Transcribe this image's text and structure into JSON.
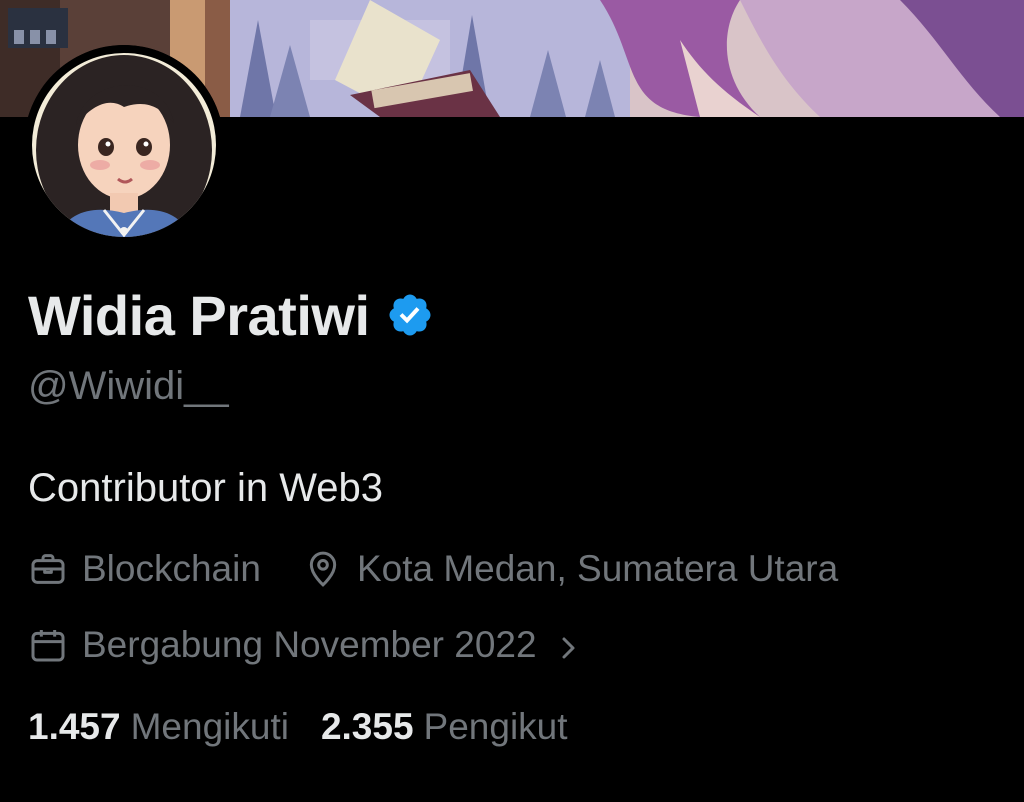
{
  "profile": {
    "display_name": "Widia Pratiwi",
    "handle": "@Wiwidi__",
    "bio": "Contributor in Web3",
    "verified_badge_color": "#1d9bf0",
    "avatar_icon": "avatar",
    "banner_icon": "profile-banner"
  },
  "meta": {
    "category": "Blockchain",
    "location": "Kota Medan, Sumatera Utara",
    "joined": "Bergabung November 2022"
  },
  "stats": {
    "following_count": "1.457",
    "following_label": "Mengikuti",
    "followers_count": "2.355",
    "followers_label": "Pengikut"
  },
  "colors": {
    "background": "#000000",
    "primary_text": "#e7e9ea",
    "secondary_text": "#71767b",
    "accent": "#1d9bf0"
  }
}
